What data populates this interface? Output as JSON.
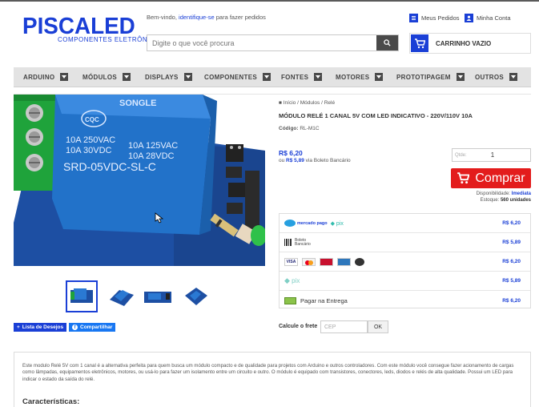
{
  "header": {
    "logo_brand": "PISCALED",
    "logo_tagline": "COMPONENTES ELETRÔNICOS",
    "welcome_prefix": "Bem-vindo,",
    "welcome_link": "identifique-se",
    "welcome_suffix": "para fazer pedidos",
    "search_placeholder": "Digite o que você procura",
    "orders_label": "Meus Pedidos",
    "account_label": "Minha Conta",
    "cart_label": "CARRINHO VAZIO"
  },
  "nav": {
    "items": [
      {
        "label": "ARDUINO"
      },
      {
        "label": "MÓDULOS"
      },
      {
        "label": "DISPLAYS"
      },
      {
        "label": "COMPONENTES"
      },
      {
        "label": "FONTES"
      },
      {
        "label": "MOTORES"
      },
      {
        "label": "PROTOTIPAGEM"
      },
      {
        "label": "OUTROS"
      }
    ]
  },
  "product": {
    "breadcrumb": [
      "Início",
      "Módulos",
      "Relé"
    ],
    "title": "MÓDULO RELÉ 1 CANAL 5V COM LED INDICATIVO - 220V/110V 10A",
    "code_label": "Código:",
    "code_value": "RL-M1C",
    "price": "R$ 6,20",
    "boleto_prefix": "ou",
    "boleto_price": "R$ 5,89",
    "boleto_suffix": "via Boleto Bancário",
    "qty_label": "Qtde:",
    "qty_value": "1",
    "buy_label": "Comprar",
    "availability_label": "Disponibilidade:",
    "availability_value": "Imediata",
    "stock_label": "Estoque:",
    "stock_value": "560",
    "stock_unit": "unidades",
    "relay_markings": {
      "brand": "SONGLE",
      "line1": "10A 250VAC",
      "line2": "10A  30VDC",
      "line3": "10A 125VAC",
      "line4": "10A  28VDC",
      "model": "SRD-05VDC-SL-C",
      "cqc": "CQC"
    }
  },
  "payments": [
    {
      "name": "mercado pago + pix",
      "logo_text": "mercado pago",
      "value": "R$ 6,20"
    },
    {
      "name": "boleto",
      "logo_text": "Boleto Bancário",
      "value": "R$ 5,89"
    },
    {
      "name": "cards",
      "logo_text": "VISA",
      "value": "R$ 6,20"
    },
    {
      "name": "pix",
      "logo_text": "pix",
      "value": "R$ 5,89"
    },
    {
      "name": "pagar na entrega",
      "logo_text": "Pagar na Entrega",
      "value": "R$ 6,20"
    }
  ],
  "actions": {
    "wishlist": "Lista de Desejos",
    "share": "Compartilhar"
  },
  "shipping": {
    "label": "Calcule o frete",
    "placeholder": "CEP",
    "button": "OK"
  },
  "description": {
    "text": "Este modulo Relé 5V com 1 canal é a alternativa perfeita para quem busca um módulo compacto e de qualidade para projetos com Arduino e outros controladores. Com este módulo você consegue fazer acionamento de cargas como lâmpadas, equipamentos eletrônicos, motores, ou usá-lo para fazer um isolamento entre um circuito e outro. O módulo é equipado com transistores, conectores, leds, diodos e relés de alta qualidade. Possui um LED para indicar o estado da saída do relé.",
    "features_title": "Características:"
  },
  "colors": {
    "brand_blue": "#1a3fd6",
    "buy_red": "#e31c1c",
    "nav_bg": "#e3e3e3"
  }
}
